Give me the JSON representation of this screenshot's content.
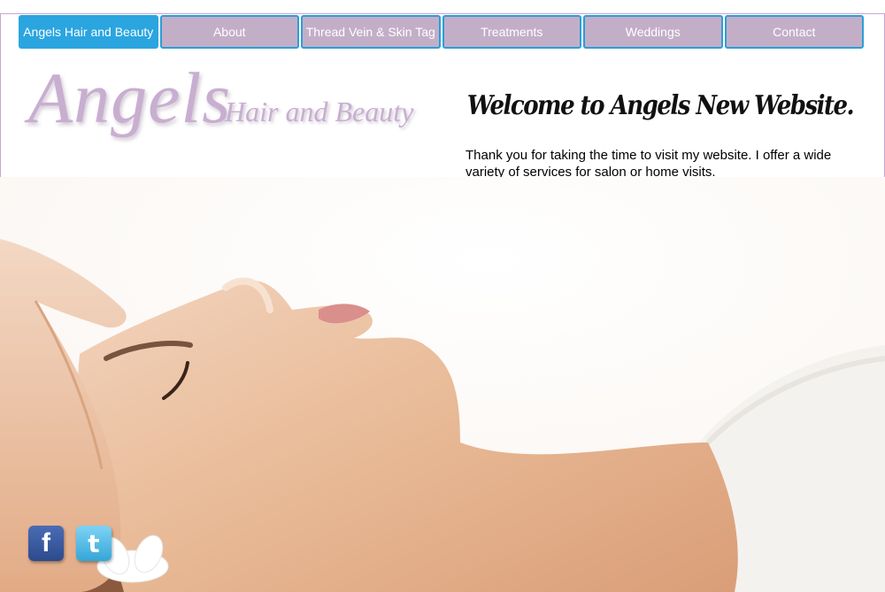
{
  "nav": {
    "items": [
      {
        "label": "Angels Hair and Beauty",
        "active": true
      },
      {
        "label": "About"
      },
      {
        "label": "Thread Vein & Skin Tag"
      },
      {
        "label": "Treatments"
      },
      {
        "label": "Weddings"
      },
      {
        "label": "Contact"
      }
    ]
  },
  "logo": {
    "main": "Angels",
    "sub": "Hair and Beauty"
  },
  "welcome": {
    "title": "Welcome to Angels New Website.",
    "text": "Thank you for taking the time to visit my website. I offer a wide variety of services for salon or home visits."
  },
  "social": {
    "facebook_glyph": "f",
    "twitter_glyph": "t"
  },
  "colors": {
    "nav_bg": "#c3aec8",
    "nav_active": "#2aa5e0",
    "nav_border": "#2a9fd8",
    "logo": "#c8aed0"
  }
}
